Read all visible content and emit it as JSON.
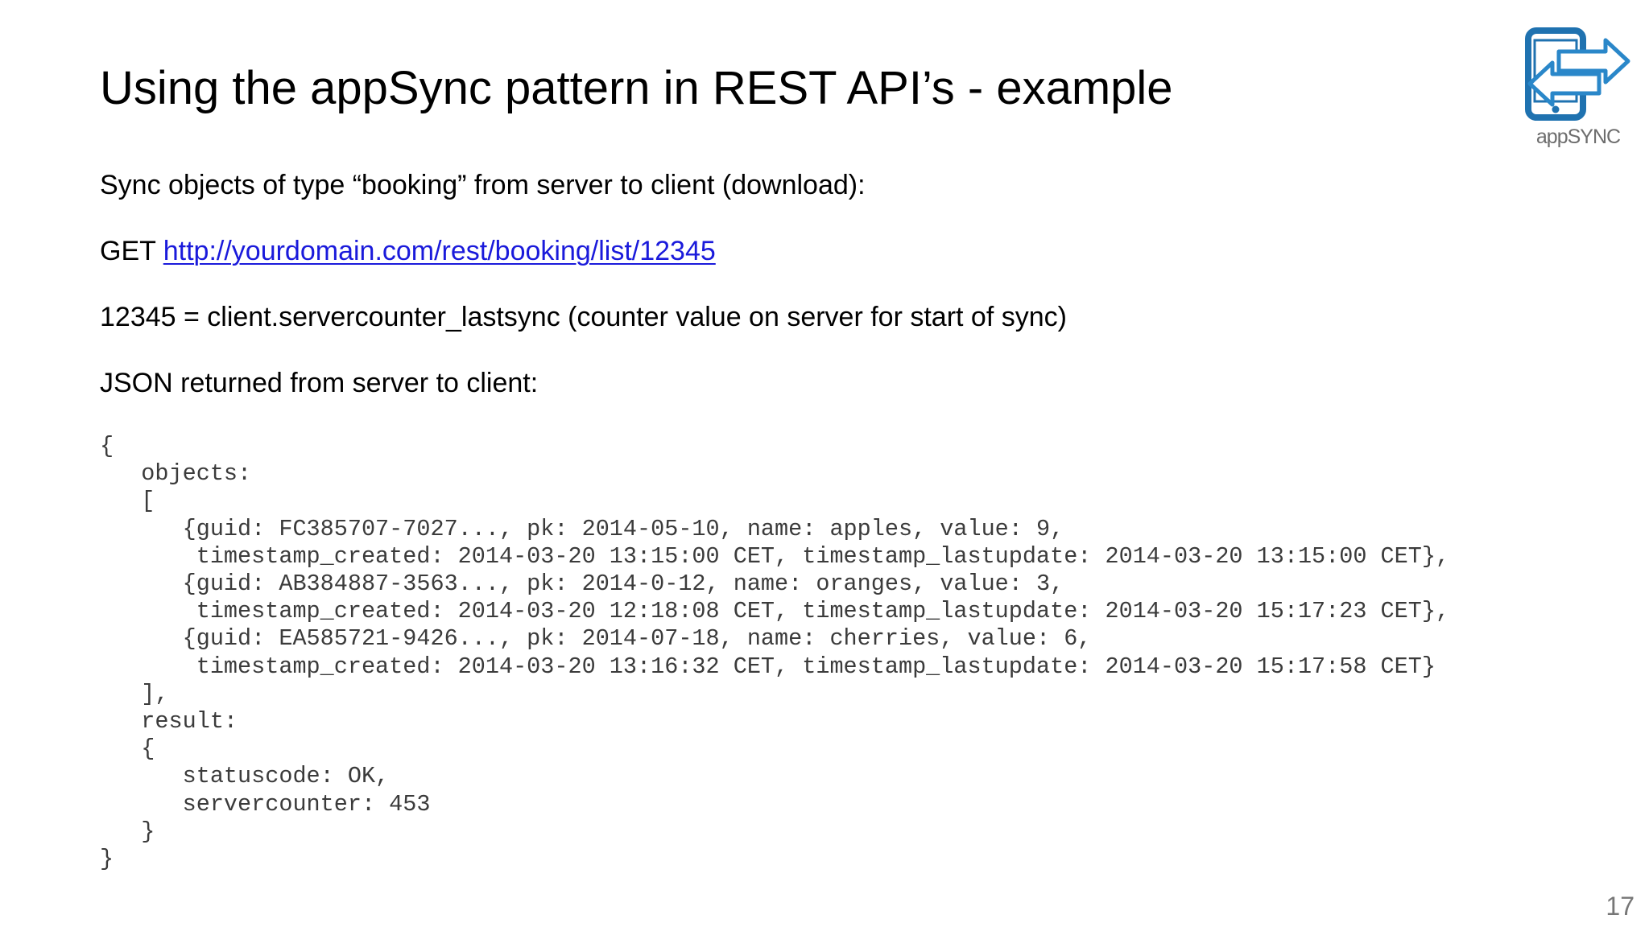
{
  "slide": {
    "title": "Using the appSync pattern in REST API’s - example",
    "logo_text": "appSYNC",
    "intro": "Sync objects of type “booking” from server to client (download):",
    "request": {
      "method": "GET",
      "url": "http://yourdomain.com/rest/booking/list/12345"
    },
    "explanation": "12345 = client.servercounter_lastsync (counter value on server for start of sync)",
    "json_heading": "JSON returned from server to client:",
    "code_lines": [
      "{",
      "   objects:",
      "   [",
      "      {guid: FC385707-7027..., pk: 2014-05-10, name: apples, value: 9,",
      "       timestamp_created: 2014-03-20 13:15:00 CET, timestamp_lastupdate: 2014-03-20 13:15:00 CET},",
      "      {guid: AB384887-3563..., pk: 2014-0-12, name: oranges, value: 3,",
      "       timestamp_created: 2014-03-20 12:18:08 CET, timestamp_lastupdate: 2014-03-20 15:17:23 CET},",
      "      {guid: EA585721-9426..., pk: 2014-07-18, name: cherries, value: 6,",
      "       timestamp_created: 2014-03-20 13:16:32 CET, timestamp_lastupdate: 2014-03-20 15:17:58 CET}",
      "   ],",
      "   result:",
      "   {",
      "      statuscode: OK,",
      "      servercounter: 453",
      "   }",
      "}"
    ],
    "page_number": "17",
    "colors": {
      "link": "#1a1adb",
      "logo_blue": "#1f72b0",
      "code_text": "#3b3b3b",
      "page_number": "#777777"
    },
    "icons": {
      "logo": "phone-sync-arrows-icon"
    }
  }
}
